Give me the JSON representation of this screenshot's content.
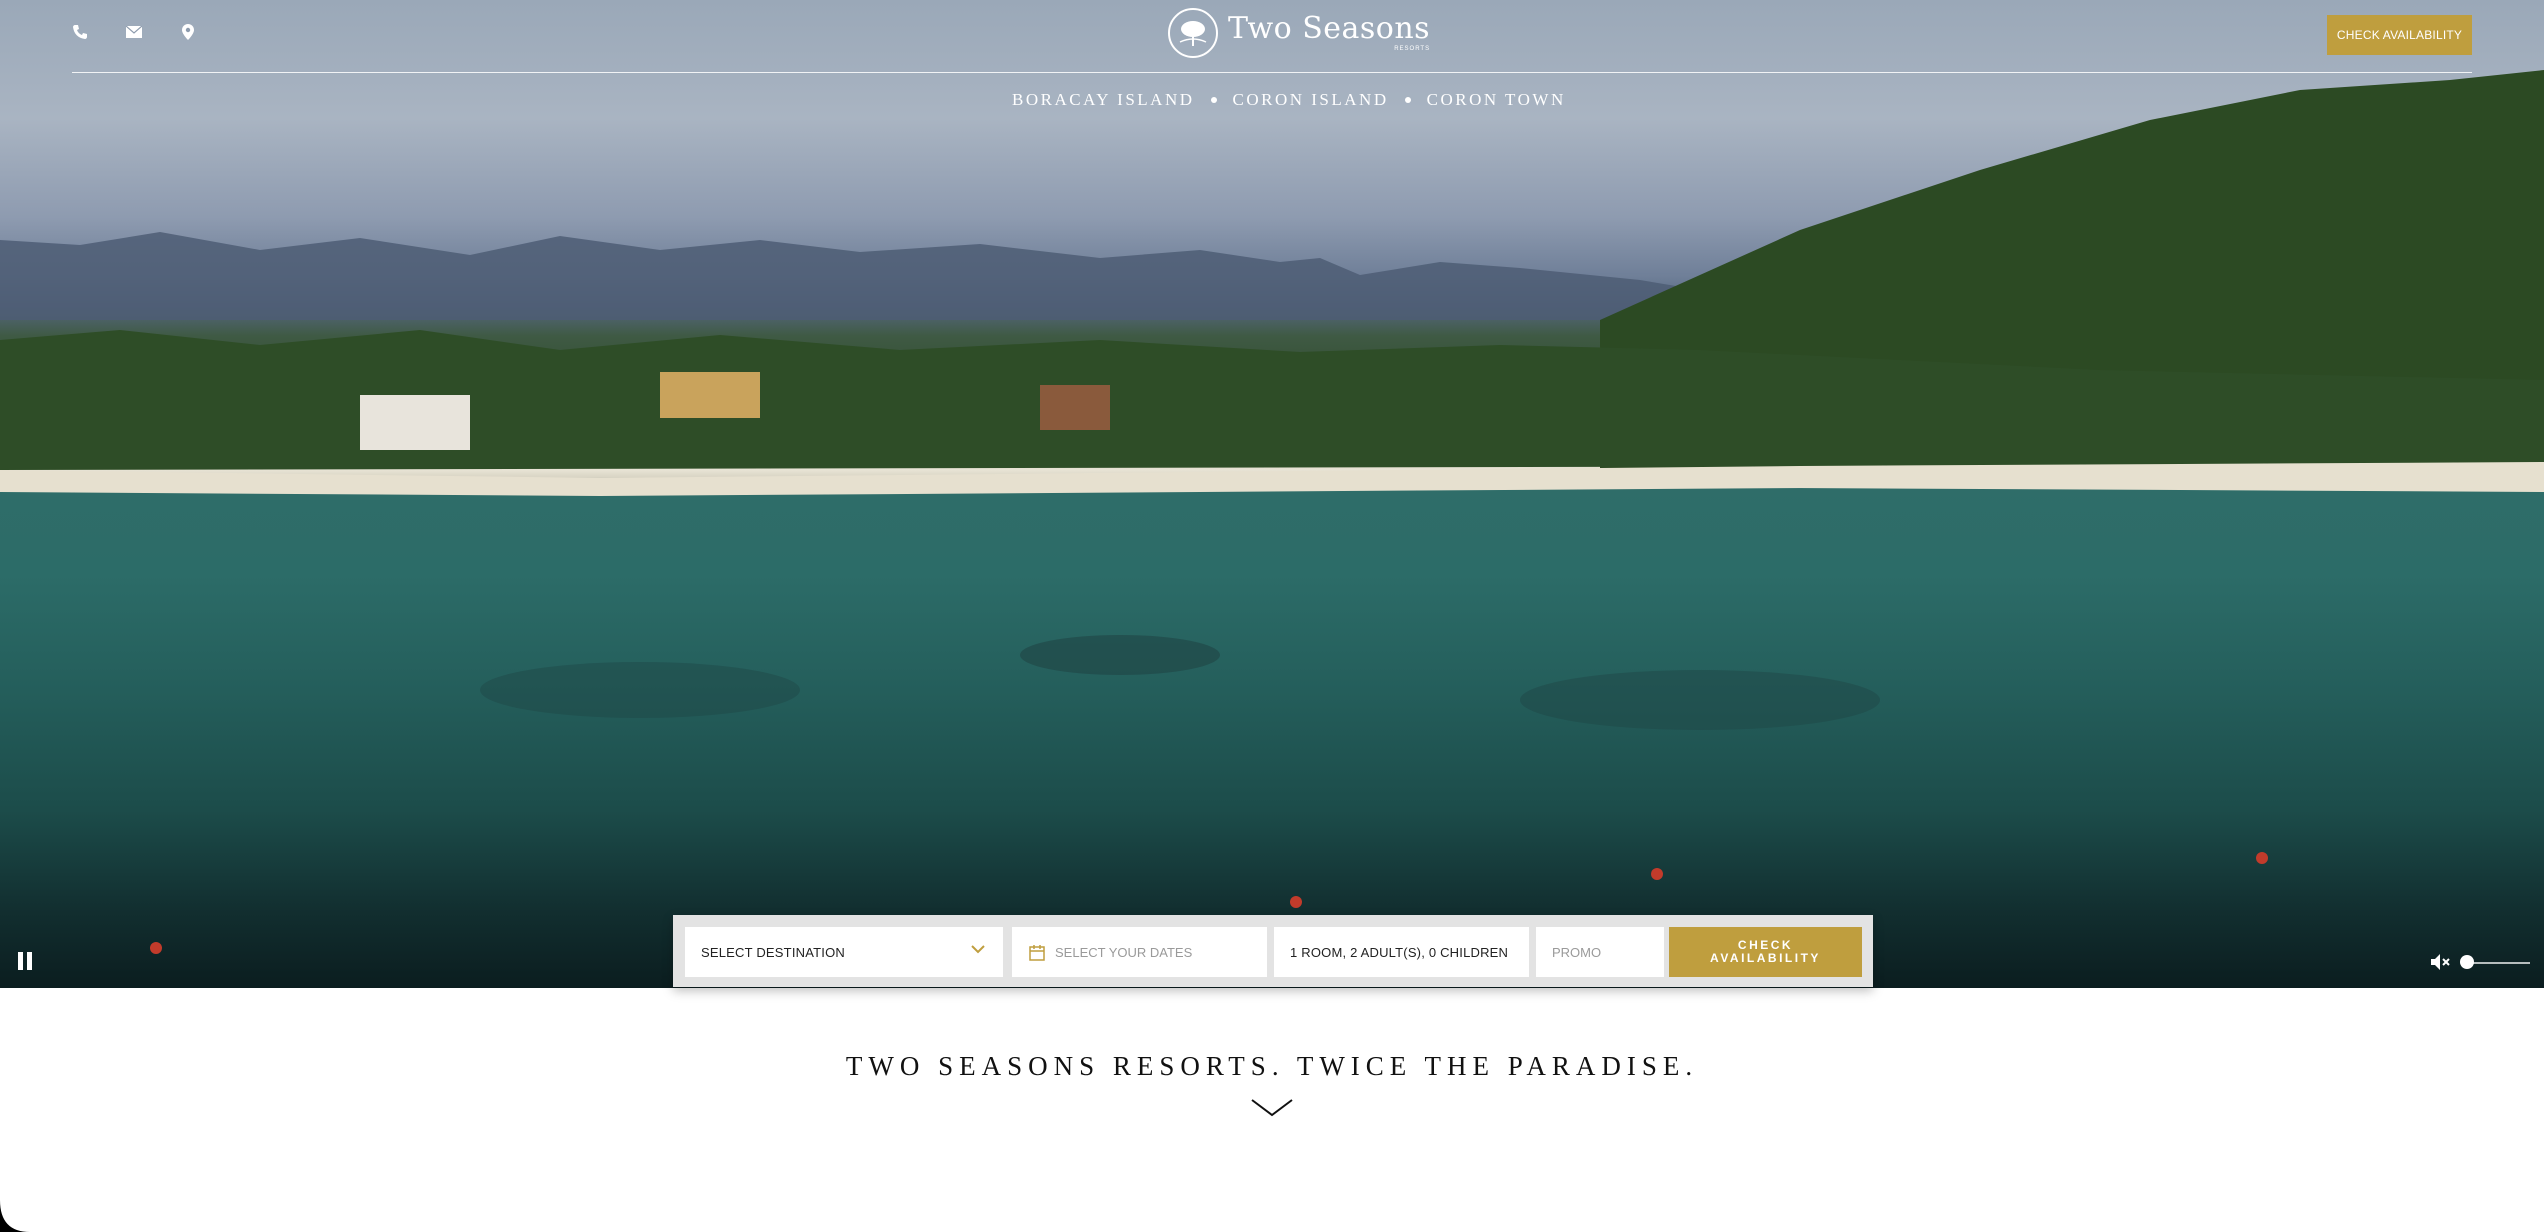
{
  "header": {
    "icons": [
      "phone-icon",
      "mail-icon",
      "location-pin-icon"
    ],
    "logo_text": "Two Seasons",
    "logo_subtext": "RESORTS",
    "check_availability_label": "CHECK AVAILABILITY"
  },
  "destinations": {
    "items": [
      "BORACAY ISLAND",
      "CORON ISLAND",
      "CORON TOWN"
    ]
  },
  "video_controls": {
    "pause_icon": "pause-icon",
    "mute_icon": "muted-speaker-icon",
    "volume_level": 0
  },
  "booking": {
    "destination_value": "SELECT DESTINATION",
    "dates_placeholder": "SELECT YOUR DATES",
    "guests_value": "1 ROOM, 2 ADULT(S), 0 CHILDREN",
    "promo_placeholder": "PROMO",
    "submit_label_line1": "CHECK",
    "submit_label_line2": "AVAILABILITY"
  },
  "main": {
    "tagline": "TWO SEASONS RESORTS. TWICE THE PARADISE."
  },
  "colors": {
    "accent_gold": "#bf9e3e",
    "text_dark": "#111111"
  }
}
